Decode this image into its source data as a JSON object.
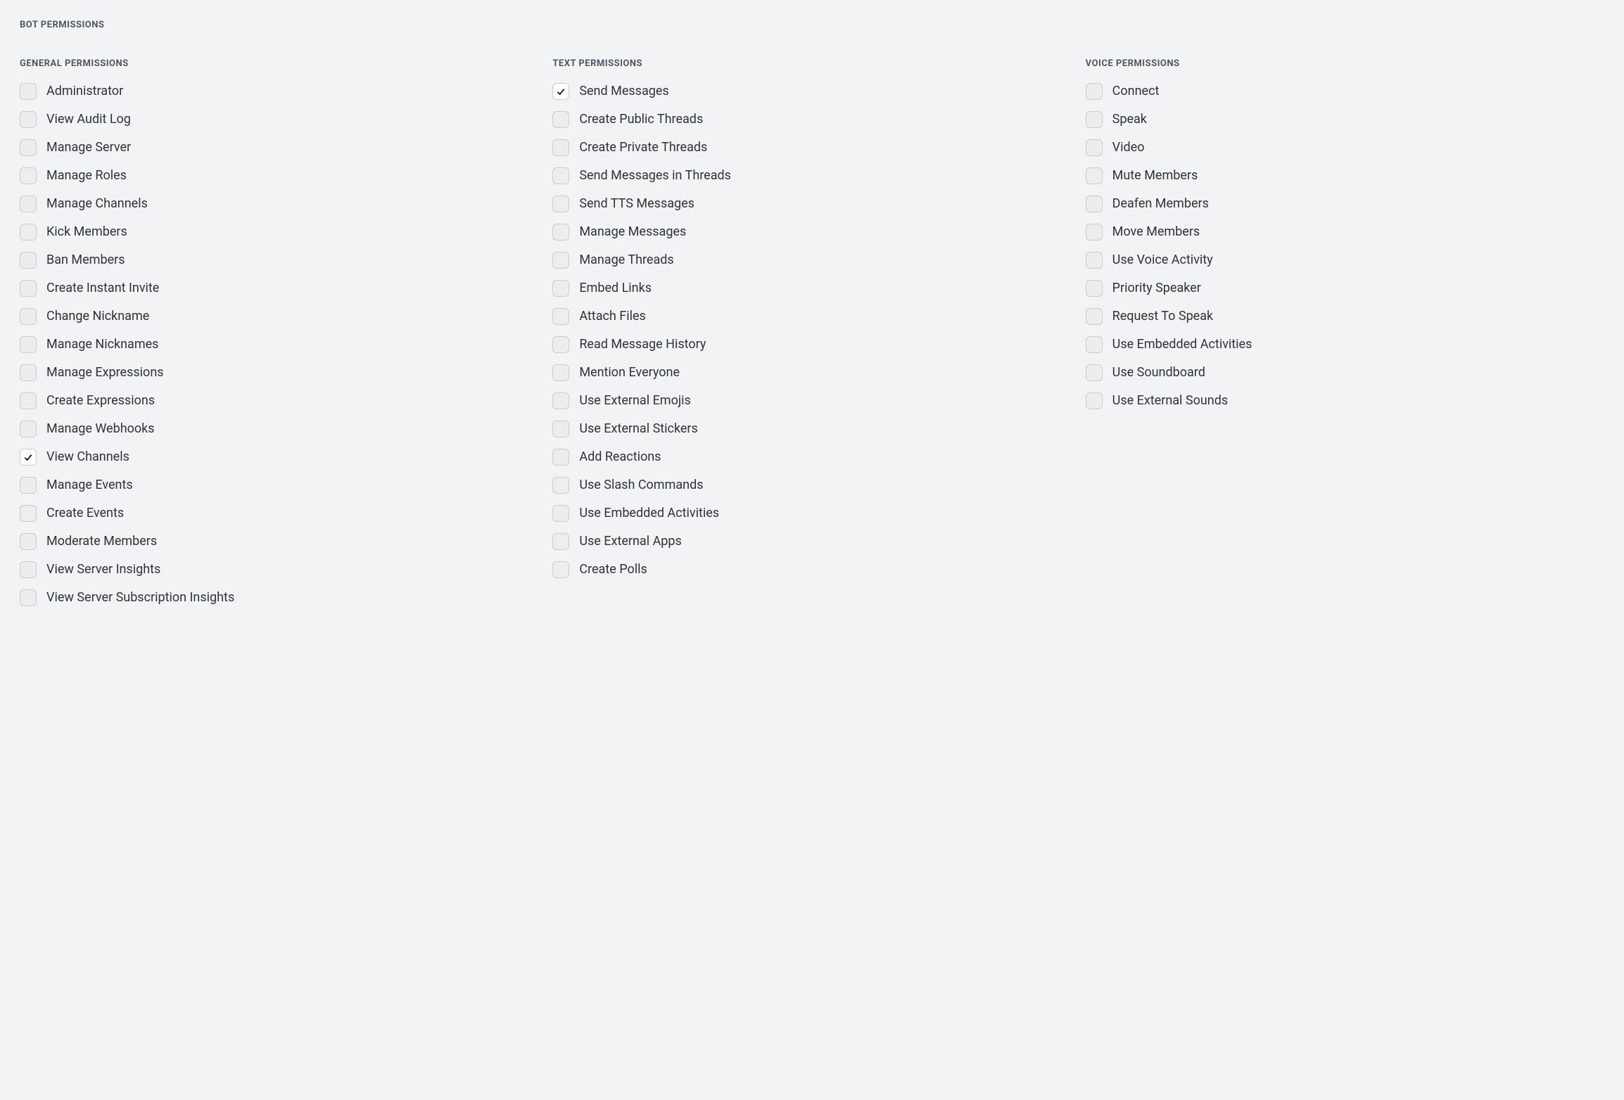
{
  "title": "Bot Permissions",
  "columns": [
    {
      "title": "General Permissions",
      "items": [
        {
          "label": "Administrator",
          "checked": false
        },
        {
          "label": "View Audit Log",
          "checked": false
        },
        {
          "label": "Manage Server",
          "checked": false
        },
        {
          "label": "Manage Roles",
          "checked": false
        },
        {
          "label": "Manage Channels",
          "checked": false
        },
        {
          "label": "Kick Members",
          "checked": false
        },
        {
          "label": "Ban Members",
          "checked": false
        },
        {
          "label": "Create Instant Invite",
          "checked": false
        },
        {
          "label": "Change Nickname",
          "checked": false
        },
        {
          "label": "Manage Nicknames",
          "checked": false
        },
        {
          "label": "Manage Expressions",
          "checked": false
        },
        {
          "label": "Create Expressions",
          "checked": false
        },
        {
          "label": "Manage Webhooks",
          "checked": false
        },
        {
          "label": "View Channels",
          "checked": true
        },
        {
          "label": "Manage Events",
          "checked": false
        },
        {
          "label": "Create Events",
          "checked": false
        },
        {
          "label": "Moderate Members",
          "checked": false
        },
        {
          "label": "View Server Insights",
          "checked": false
        },
        {
          "label": "View Server Subscription Insights",
          "checked": false
        }
      ]
    },
    {
      "title": "Text Permissions",
      "items": [
        {
          "label": "Send Messages",
          "checked": true
        },
        {
          "label": "Create Public Threads",
          "checked": false
        },
        {
          "label": "Create Private Threads",
          "checked": false
        },
        {
          "label": "Send Messages in Threads",
          "checked": false
        },
        {
          "label": "Send TTS Messages",
          "checked": false
        },
        {
          "label": "Manage Messages",
          "checked": false
        },
        {
          "label": "Manage Threads",
          "checked": false
        },
        {
          "label": "Embed Links",
          "checked": false
        },
        {
          "label": "Attach Files",
          "checked": false
        },
        {
          "label": "Read Message History",
          "checked": false
        },
        {
          "label": "Mention Everyone",
          "checked": false
        },
        {
          "label": "Use External Emojis",
          "checked": false
        },
        {
          "label": "Use External Stickers",
          "checked": false
        },
        {
          "label": "Add Reactions",
          "checked": false
        },
        {
          "label": "Use Slash Commands",
          "checked": false
        },
        {
          "label": "Use Embedded Activities",
          "checked": false
        },
        {
          "label": "Use External Apps",
          "checked": false
        },
        {
          "label": "Create Polls",
          "checked": false
        }
      ]
    },
    {
      "title": "Voice Permissions",
      "items": [
        {
          "label": "Connect",
          "checked": false
        },
        {
          "label": "Speak",
          "checked": false
        },
        {
          "label": "Video",
          "checked": false
        },
        {
          "label": "Mute Members",
          "checked": false
        },
        {
          "label": "Deafen Members",
          "checked": false
        },
        {
          "label": "Move Members",
          "checked": false
        },
        {
          "label": "Use Voice Activity",
          "checked": false
        },
        {
          "label": "Priority Speaker",
          "checked": false
        },
        {
          "label": "Request To Speak",
          "checked": false
        },
        {
          "label": "Use Embedded Activities",
          "checked": false
        },
        {
          "label": "Use Soundboard",
          "checked": false
        },
        {
          "label": "Use External Sounds",
          "checked": false
        }
      ]
    }
  ]
}
